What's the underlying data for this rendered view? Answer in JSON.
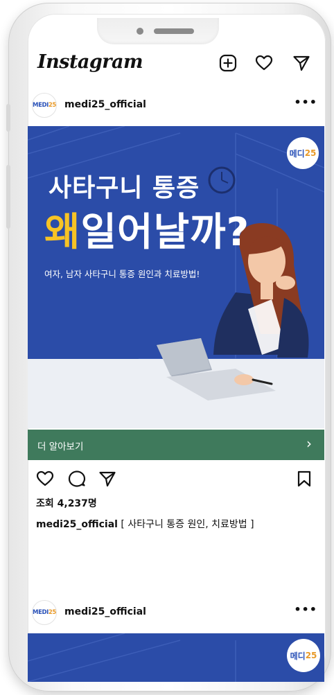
{
  "header": {
    "logo": "Instagram",
    "logo_chevron": "⌄",
    "icons": [
      "new-post-icon",
      "heart-icon",
      "direct-message-icon"
    ]
  },
  "post1": {
    "username": "medi25_official",
    "avatar_text_main": "MEDI",
    "avatar_text_accent": "25",
    "more": "•••",
    "image": {
      "badge_main": "메디",
      "badge_accent": "25",
      "title_line1": "사타구니 통증",
      "title_highlight": "왜",
      "title_rest": "일어날까?",
      "subtitle": "여자, 남자 사타구니 통증 원인과 치료방법!"
    },
    "cta_label": "더 알아보기",
    "cta_arrow": "›",
    "views": "조회 4,237명",
    "caption_user": "medi25_official",
    "caption_text": " [ 사타구니 통증 원인, 치료방법 ]"
  },
  "post2": {
    "username": "medi25_official",
    "avatar_text_main": "MEDI",
    "avatar_text_accent": "25",
    "more": "•••",
    "badge_main": "메디",
    "badge_accent": "25"
  },
  "colors": {
    "brand_blue": "#2b4ca8",
    "highlight_yellow": "#f7c325",
    "cta_green": "#3f7a5c",
    "accent_orange": "#e89a2a"
  }
}
